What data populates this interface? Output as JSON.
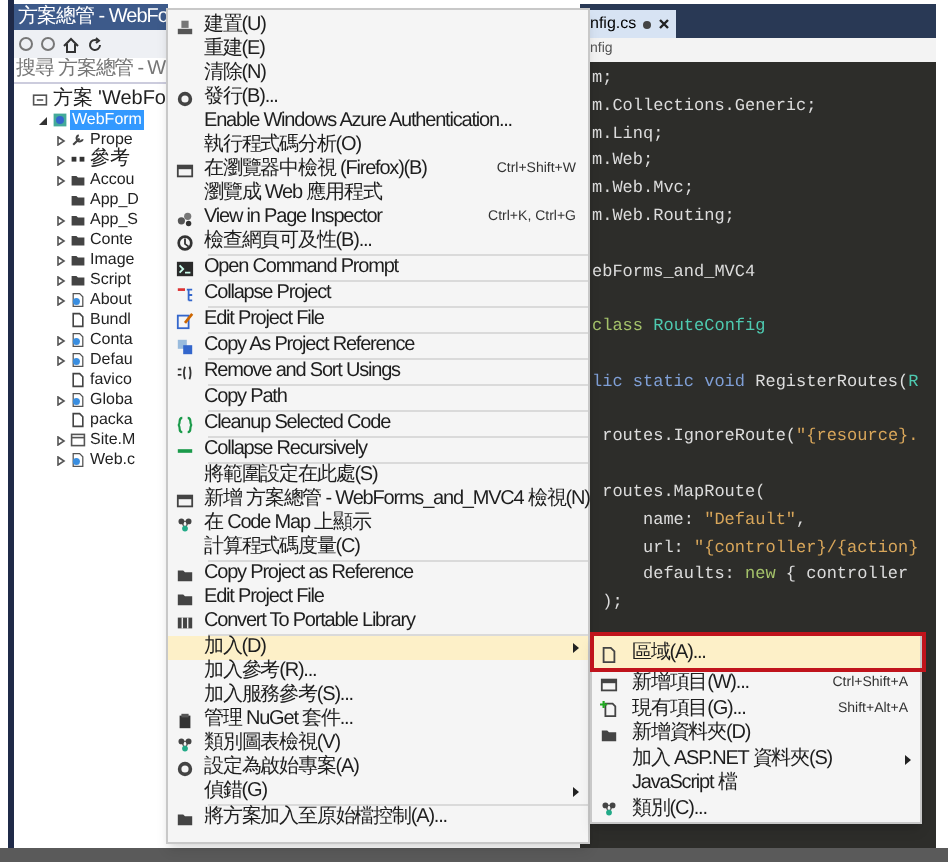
{
  "explorer": {
    "title": "方案總管 - WebFo",
    "search": {
      "placeholder": "搜尋 方案總管 - W"
    },
    "tree": [
      {
        "label": "方案 'WebFo",
        "kind": "solution",
        "selected": false,
        "children": [
          {
            "label": "WebForm",
            "kind": "project",
            "selected": true,
            "expanded": true,
            "children": [
              {
                "label": "Prope",
                "kind": "wrench",
                "selected": false,
                "expanded": false
              },
              {
                "label": "參考",
                "kind": "references",
                "selected": false,
                "expanded": false
              },
              {
                "label": "Accou",
                "kind": "folder",
                "selected": false,
                "expanded": false
              },
              {
                "label": "App_D",
                "kind": "folder",
                "selected": false
              },
              {
                "label": "App_S",
                "kind": "folder",
                "selected": false,
                "expanded": false
              },
              {
                "label": "Conte",
                "kind": "folder",
                "selected": false,
                "expanded": false
              },
              {
                "label": "Image",
                "kind": "folder",
                "selected": false,
                "expanded": false
              },
              {
                "label": "Script",
                "kind": "folder",
                "selected": false,
                "expanded": false
              },
              {
                "label": "About",
                "kind": "webpage",
                "selected": false,
                "expanded": false
              },
              {
                "label": "Bundl",
                "kind": "file",
                "selected": false
              },
              {
                "label": "Conta",
                "kind": "webpage",
                "selected": false,
                "expanded": false
              },
              {
                "label": "Defau",
                "kind": "webpage",
                "selected": false,
                "expanded": false
              },
              {
                "label": "favico",
                "kind": "file",
                "selected": false
              },
              {
                "label": "Globa",
                "kind": "webpage",
                "selected": false,
                "expanded": false
              },
              {
                "label": "packa",
                "kind": "file",
                "selected": false
              },
              {
                "label": "Site.M",
                "kind": "master",
                "selected": false,
                "expanded": false
              },
              {
                "label": "Web.c",
                "kind": "webpage",
                "selected": false,
                "expanded": false
              }
            ]
          }
        ]
      }
    ]
  },
  "editor": {
    "tab": {
      "label": "nfig.cs"
    },
    "breadcrumb": "nfig",
    "lines": [
      {
        "tokens": [
          {
            "text": "m;",
            "kind": "plain"
          }
        ]
      },
      {
        "tokens": [
          {
            "text": "m.Collections.Generic;",
            "kind": "plain"
          }
        ]
      },
      {
        "tokens": [
          {
            "text": "m.Linq;",
            "kind": "plain"
          }
        ]
      },
      {
        "tokens": [
          {
            "text": "m.Web;",
            "kind": "plain"
          }
        ]
      },
      {
        "tokens": [
          {
            "text": "m.Web.Mvc;",
            "kind": "plain"
          }
        ]
      },
      {
        "tokens": [
          {
            "text": "m.Web.Routing;",
            "kind": "plain"
          }
        ],
        "space_after": true
      },
      {
        "tokens": [
          {
            "text": "ebForms_and_MVC4",
            "kind": "plain"
          }
        ],
        "space_after": true
      },
      {
        "tokens": [
          {
            "text": "class",
            "kind": "keyword2"
          },
          {
            "text": " RouteConfig",
            "kind": "type"
          }
        ],
        "space_after": true
      },
      {
        "tokens": [
          {
            "text": "lic static void",
            "kind": "keyword"
          },
          {
            "text": " RegisterRoutes(",
            "kind": "plain"
          },
          {
            "text": "R",
            "kind": "type"
          }
        ],
        "space_after": true
      },
      {
        "tokens": [
          {
            "text": " routes.IgnoreRoute(",
            "kind": "plain"
          },
          {
            "text": "\"{resource}.",
            "kind": "string"
          }
        ],
        "space_after": true
      },
      {
        "tokens": [
          {
            "text": " routes.MapRoute(",
            "kind": "plain"
          }
        ]
      },
      {
        "tokens": [
          {
            "text": "     name: ",
            "kind": "plain"
          },
          {
            "text": "\"Default\"",
            "kind": "string"
          },
          {
            "text": ",",
            "kind": "plain"
          }
        ]
      },
      {
        "tokens": [
          {
            "text": "     url: ",
            "kind": "plain"
          },
          {
            "text": "\"{controller}/{action}",
            "kind": "string"
          }
        ]
      },
      {
        "tokens": [
          {
            "text": "     defaults: ",
            "kind": "plain"
          },
          {
            "text": "new",
            "kind": "keyword2"
          },
          {
            "text": " { controller",
            "kind": "plain"
          }
        ]
      },
      {
        "tokens": [
          {
            "text": " );",
            "kind": "plain"
          }
        ]
      }
    ]
  },
  "context_menu": {
    "groups": [
      [
        {
          "label": "建置(U)",
          "selected": false
        },
        {
          "label": "重建(E)",
          "selected": false
        },
        {
          "label": "清除(N)",
          "selected": false
        },
        {
          "label": "發行(B)...",
          "selected": false
        },
        {
          "label": "Enable Windows Azure Authentication...",
          "selected": false
        },
        {
          "label": "執行程式碼分析(O)",
          "selected": false
        },
        {
          "label": "在瀏覽器中檢視 (Firefox)(B)",
          "shortcut": "Ctrl+Shift+W",
          "selected": false
        },
        {
          "label": "瀏覽成 Web 應用程式",
          "selected": false
        },
        {
          "label": "View in Page Inspector",
          "shortcut": "Ctrl+K, Ctrl+G",
          "selected": false
        },
        {
          "label": "檢查網頁可及性(B)...",
          "selected": false
        }
      ],
      [
        {
          "label": "Open Command Prompt",
          "selected": false
        }
      ],
      [
        {
          "label": "Collapse Project",
          "selected": false
        }
      ],
      [
        {
          "label": "Edit Project File",
          "selected": false
        }
      ],
      [
        {
          "label": "Copy As Project Reference",
          "selected": false
        }
      ],
      [
        {
          "label": "Remove and Sort Usings",
          "selected": false
        }
      ],
      [
        {
          "label": "Copy Path",
          "selected": false
        }
      ],
      [
        {
          "label": "Cleanup Selected Code",
          "selected": false
        }
      ],
      [
        {
          "label": "Collapse Recursively",
          "selected": false
        }
      ],
      [
        {
          "label": "將範圍設定在此處(S)",
          "selected": false
        },
        {
          "label": "新增 方案總管 - WebForms_and_MVC4 檢視(N)",
          "selected": false
        },
        {
          "label": "在 Code Map 上顯示",
          "selected": false
        },
        {
          "label": "計算程式碼度量(C)",
          "selected": false
        }
      ],
      [
        {
          "label": "Copy Project as Reference",
          "selected": false
        },
        {
          "label": "Edit Project File",
          "selected": false
        },
        {
          "label": "Convert To Portable Library",
          "selected": false
        }
      ],
      [
        {
          "label": "加入(D)",
          "selected": true,
          "submenu": true
        },
        {
          "label": "加入參考(R)...",
          "selected": false
        },
        {
          "label": "加入服務參考(S)...",
          "selected": false
        },
        {
          "label": "管理 NuGet 套件...",
          "selected": false
        },
        {
          "label": "類別圖表檢視(V)",
          "selected": false
        },
        {
          "label": "設定為啟始專案(A)",
          "selected": false
        },
        {
          "label": "偵錯(G)",
          "selected": false,
          "submenu": true
        }
      ],
      [
        {
          "label": "將方案加入至原始檔控制(A)...",
          "selected": false
        }
      ]
    ]
  },
  "submenu": {
    "items": [
      {
        "label": "區域(A)...",
        "selected": true
      },
      {
        "label": "新增項目(W)...",
        "shortcut": "Ctrl+Shift+A",
        "selected": false
      },
      {
        "label": "現有項目(G)...",
        "shortcut": "Shift+Alt+A",
        "selected": false
      },
      {
        "label": "新增資料夾(D)",
        "selected": false
      },
      {
        "label": "加入 ASP.NET 資料夾(S)",
        "selected": false,
        "submenu": true
      },
      {
        "label": "JavaScript 檔",
        "selected": false
      },
      {
        "label": "類別(C)...",
        "selected": false
      }
    ]
  }
}
